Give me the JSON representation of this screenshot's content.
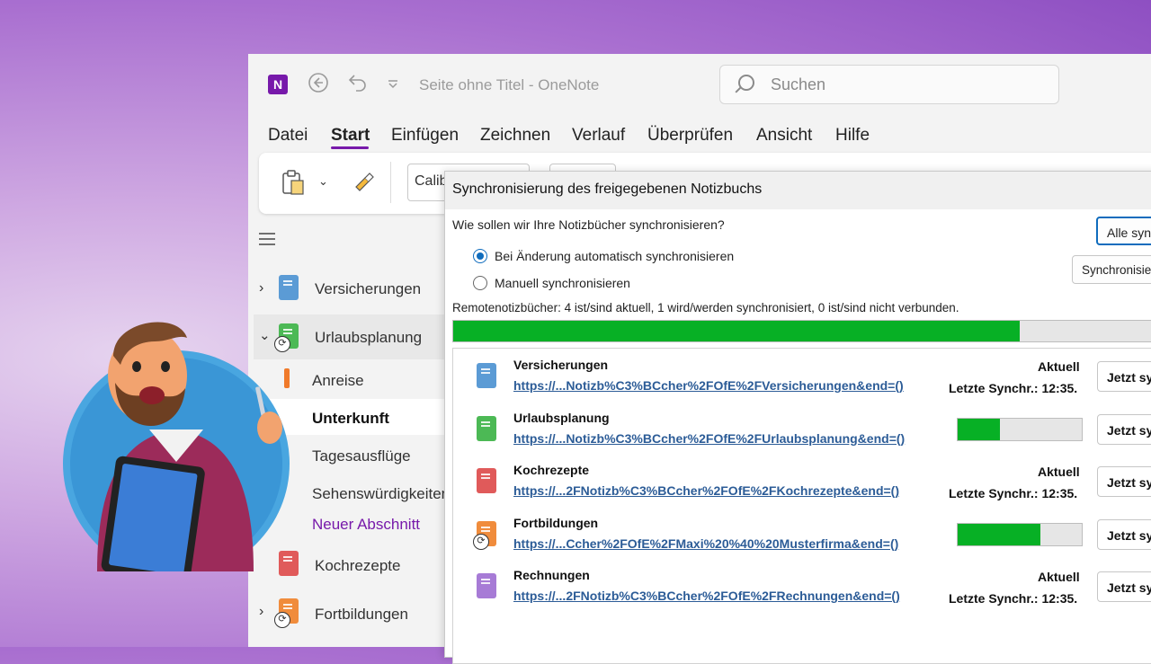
{
  "window": {
    "app_icon_letter": "N",
    "title": "Seite ohne Titel  -  OneNote",
    "search_placeholder": "Suchen",
    "menu": [
      "Datei",
      "Start",
      "Einfügen",
      "Zeichnen",
      "Verlauf",
      "Überprüfen",
      "Ansicht",
      "Hilfe"
    ],
    "active_menu": "Start",
    "font_name": "Calib"
  },
  "sidebar": {
    "notebooks": [
      {
        "label": "Versicherungen",
        "color": "#5b9bd5"
      },
      {
        "label": "Urlaubsplanung",
        "color": "#4cb955"
      },
      {
        "label": "Kochrezepte",
        "color": "#e05a5a"
      },
      {
        "label": "Fortbildungen",
        "color": "#f08c3c"
      }
    ],
    "sections": [
      "Anreise",
      "Unterkunft",
      "Tagesausflüge",
      "Sehenswürdigkeiten",
      "Neuer Abschnitt"
    ],
    "active_section": "Unterkunft"
  },
  "dialog": {
    "title": "Synchronisierung des freigegebenen Notizbuchs",
    "question": "Wie sollen wir Ihre Notizbücher synchronisieren?",
    "option_auto": "Bei Änderung automatisch synchronisieren",
    "option_manual": "Manuell synchronisieren",
    "selected_option": "auto",
    "sync_all_button": "Alle synchronisieren",
    "sync_button": "Synchronisieren",
    "summary": "Remotenotizbücher: 4 ist/sind aktuell, 1 wird/werden synchronisiert, 0 ist/sind nicht verbunden.",
    "overall_progress": 0.79,
    "notebooks": [
      {
        "name": "Versicherungen",
        "url": "https://...Notizb%C3%BCcher%2FOfE%2FVersicherungen&end=()",
        "status": "Aktuell",
        "last_sync": "Letzte Synchr.: 12:35.",
        "progress": null,
        "color": "#5b9bd5",
        "button": "Jetzt synchronisieren"
      },
      {
        "name": "Urlaubsplanung",
        "url": "https://...Notizb%C3%BCcher%2FOfE%2FUrlaubsplanung&end=()",
        "status": "",
        "last_sync": "",
        "progress": 0.34,
        "color": "#4cb955",
        "button": "Jetzt synchronisieren"
      },
      {
        "name": "Kochrezepte",
        "url": "https://...2FNotizb%C3%BCcher%2FOfE%2FKochrezepte&end=()",
        "status": "Aktuell",
        "last_sync": "Letzte Synchr.: 12:35.",
        "progress": null,
        "color": "#e05a5a",
        "button": "Jetzt synchronisieren"
      },
      {
        "name": "Fortbildungen",
        "url": "https://...Ccher%2FOfE%2FMaxi%20%40%20Musterfirma&end=()",
        "status": "",
        "last_sync": "",
        "progress": 0.67,
        "color": "#f08c3c",
        "button": "Jetzt synchronisieren"
      },
      {
        "name": "Rechnungen",
        "url": "https://...2FNotizb%C3%BCcher%2FOfE%2FRechnungen&end=()",
        "status": "Aktuell",
        "last_sync": "Letzte Synchr.: 12:35.",
        "progress": null,
        "color": "#a77bd6",
        "button": "Jetzt synchronisieren"
      }
    ]
  },
  "colors": {
    "accent": "#7719aa",
    "progress": "#07b025",
    "link": "#2c5c97"
  }
}
